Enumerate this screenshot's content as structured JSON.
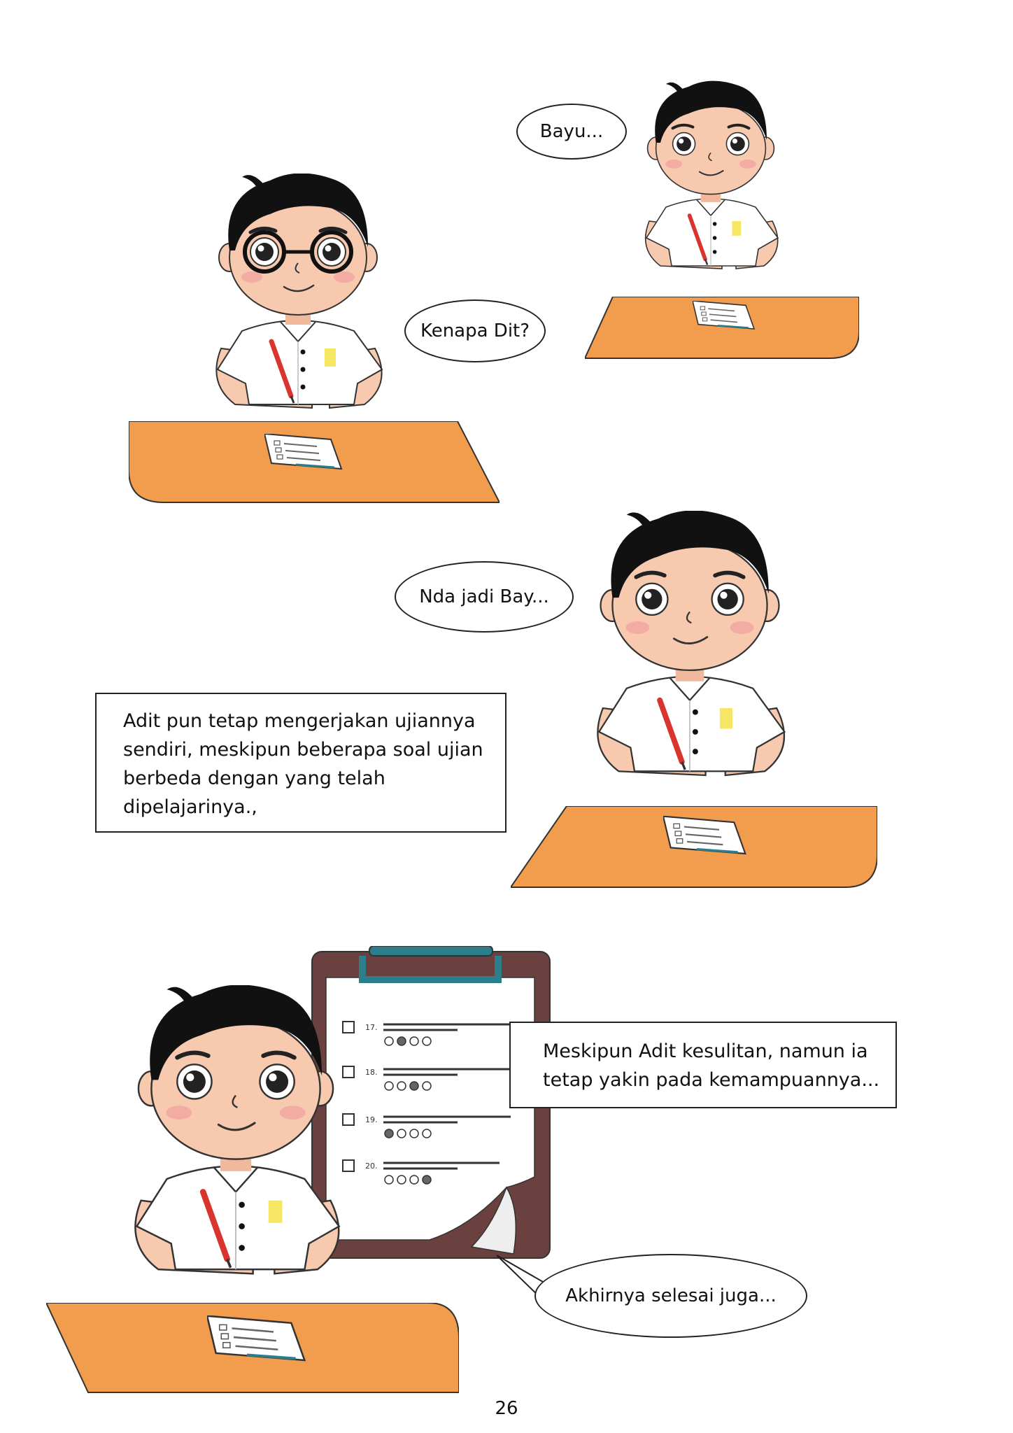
{
  "panels": {
    "panel1": {
      "adit_speech": "Kenapa Dit?",
      "bayu_speech": "Bayu..."
    },
    "panel2": {
      "speech": "Nda jadi Bay...",
      "caption_lines": [
        "Adit pun tetap mengerjakan ujiannya",
        "sendiri, meskipun beberapa soal ujian",
        "berbeda dengan yang telah",
        "dipelajarinya.,"
      ]
    },
    "panel3": {
      "caption_lines": [
        "Meskipun Adit kesulitan, namun ia",
        "tetap yakin pada kemampuannya..."
      ],
      "speech": "Akhirnya selesai juga...",
      "clipboard_questions": [
        "17.",
        "18.",
        "19.",
        "20."
      ]
    }
  },
  "page_number": "26",
  "colors": {
    "desk": "#F29C4D",
    "hair": "#111111",
    "skin": "#F7C9AE",
    "shirt": "#FFFFFF",
    "badge": "#F5E663",
    "clipboard": "#6B4140",
    "clip": "#2C7E8C"
  }
}
